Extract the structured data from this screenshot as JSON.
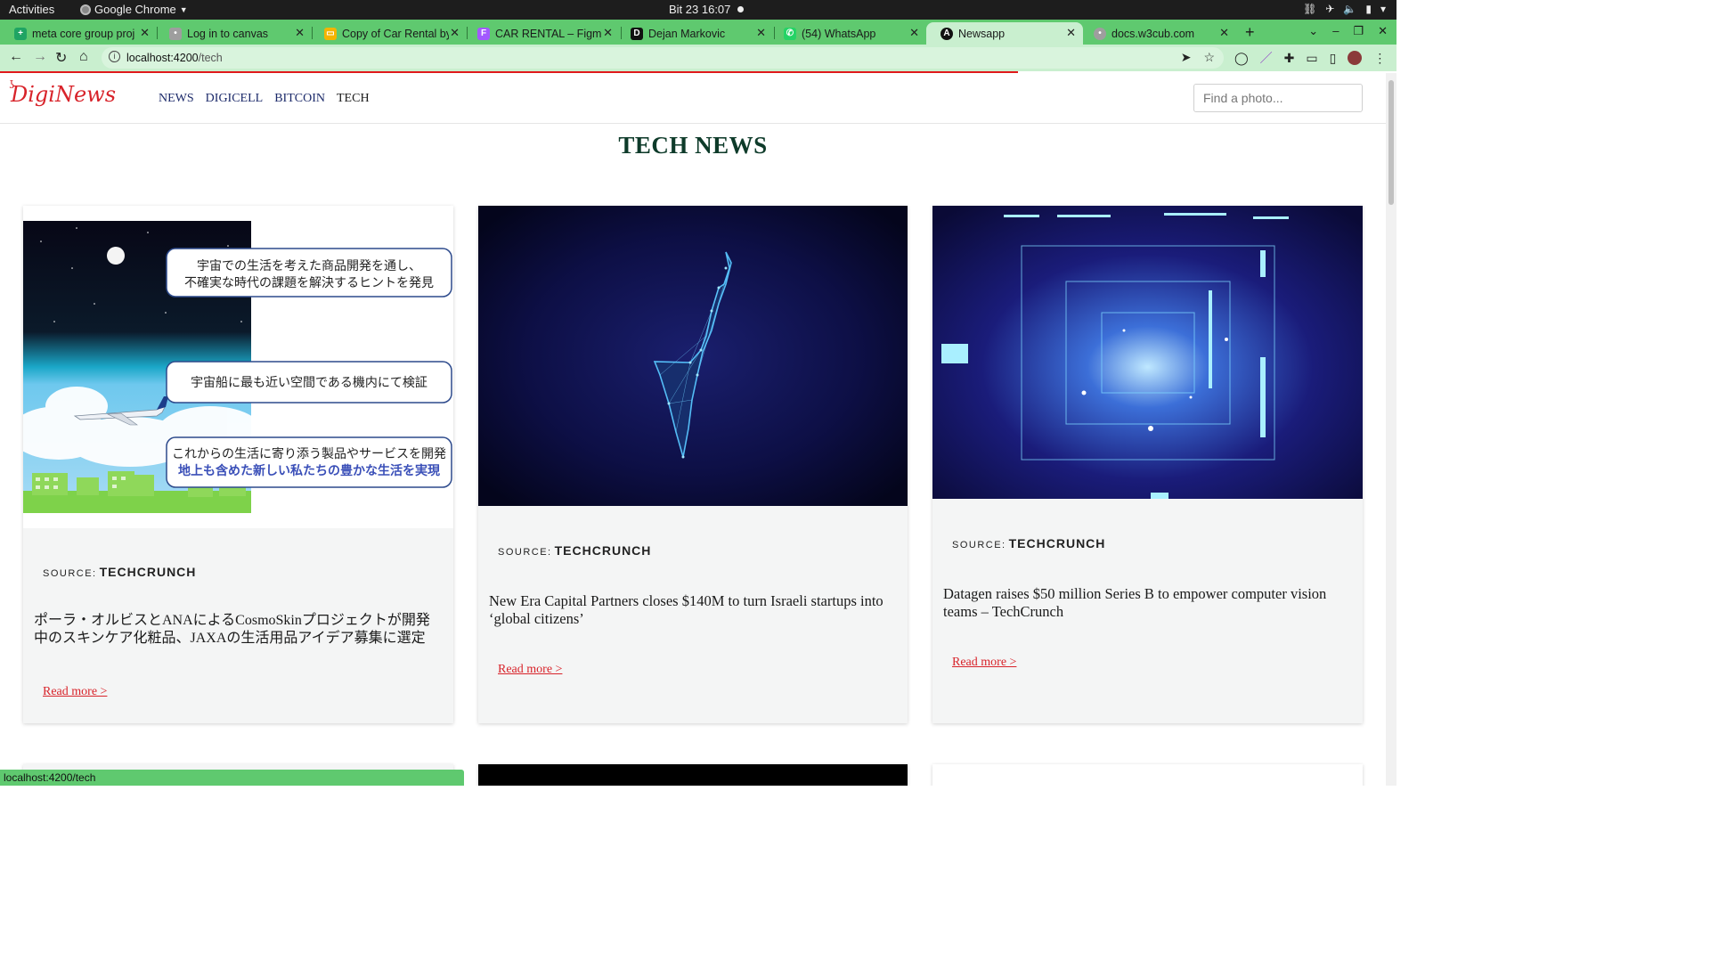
{
  "os_bar": {
    "activities": "Activities",
    "app_name": "Google Chrome",
    "clock": "Bit 23  16:07"
  },
  "browser": {
    "tabs": [
      {
        "title": "meta core group proj",
        "favicon_color": "#1fa463",
        "favicon_glyph": "+"
      },
      {
        "title": "Log in to canvas",
        "favicon_color": "#9e9e9e",
        "favicon_glyph": "•"
      },
      {
        "title": "Copy of Car Rental by",
        "favicon_color": "#f4b400",
        "favicon_glyph": "▭"
      },
      {
        "title": "CAR RENTAL – Figma",
        "favicon_color": "#a259ff",
        "favicon_glyph": "F"
      },
      {
        "title": "Dejan Markovic",
        "favicon_color": "#111111",
        "favicon_glyph": "D"
      },
      {
        "title": "(54) WhatsApp",
        "favicon_color": "#25d366",
        "favicon_glyph": "✆"
      },
      {
        "title": "Newsapp",
        "favicon_color": "#c62828",
        "favicon_glyph": "A"
      },
      {
        "title": "docs.w3cub.com",
        "favicon_color": "#9e9e9e",
        "favicon_glyph": "•"
      }
    ],
    "url_host": "localhost:4200",
    "url_path": "/tech",
    "status_url": "localhost:4200/tech"
  },
  "site": {
    "logo": "DigiNews",
    "nav": [
      "NEWS",
      "DIGICELL",
      "BITCOIN",
      "TECH"
    ],
    "search_placeholder": "Find a photo...",
    "page_heading": "TECH NEWS"
  },
  "articles": [
    {
      "source_label": "SOURCE:",
      "source": "TECHCRUNCH",
      "title": "ポーラ・オルビスとANAによるCosmoSkinプロジェクトが開発中のスキンケア化粧品、JAXAの生活用品アイデア募集に選定",
      "read_more": "Read more >",
      "image_callouts": [
        "宇宙での生活を考えた商品開発を通し、",
        "不確実な時代の課題を解決するヒントを発見",
        "宇宙船に最も近い空間である機内にて検証",
        "これからの生活に寄り添う製品やサービスを開発",
        "地上も含めた新しい私たちの豊かな生活を実現"
      ]
    },
    {
      "source_label": "SOURCE:",
      "source": "TECHCRUNCH",
      "title": "New Era Capital Partners closes $140M to turn Israeli startups into ‘global citizens’",
      "read_more": "Read more >"
    },
    {
      "source_label": "SOURCE:",
      "source": "TECHCRUNCH",
      "title": "Datagen raises $50 million Series B to empower computer vision teams – TechCrunch",
      "read_more": "Read more >"
    }
  ],
  "colors": {
    "brand_red": "#d8232a",
    "heading_green": "#0e3b2a",
    "tab_green": "#5fc96f",
    "nav_blue": "#1c2a6a"
  }
}
